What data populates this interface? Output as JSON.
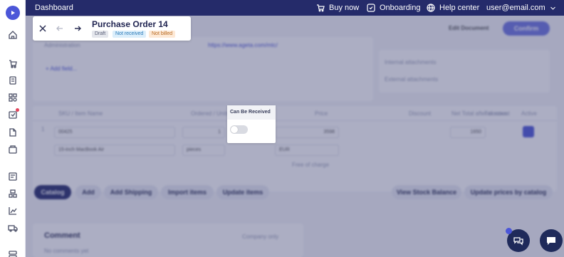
{
  "topbar": {
    "title": "Dashboard",
    "buy_now": "Buy now",
    "onboarding": "Onboarding",
    "help_center": "Help center",
    "user_email": "user@email.com"
  },
  "header": {
    "title": "Purchase Order 14",
    "badges": [
      {
        "label": "Draft",
        "bg": "#e4e6ec",
        "fg": "#5a5f78"
      },
      {
        "label": "Not received",
        "bg": "#dbeefb",
        "fg": "#2a7ab8"
      },
      {
        "label": "Not billed",
        "bg": "#fde9d6",
        "fg": "#b86a22"
      }
    ],
    "edit_document": "Edit Document",
    "confirm": "Confirm"
  },
  "info": {
    "administration": "Administration",
    "url": "https://www.ageta.com/mtc/",
    "add_field": "+ Add field...",
    "internal_attachments": "Internal attachments",
    "external_attachments": "External attachments"
  },
  "table": {
    "headers": {
      "sku_item_name": "SKU / Item Name",
      "ordered_units": "Ordered / Units",
      "price": "Price",
      "discount": "Discount",
      "net_total": "Net Total after discount",
      "tax_rates": "Tax rates",
      "active": "Active"
    },
    "row": {
      "index": "1",
      "sku": "00425",
      "qty": "1",
      "name": "15-inch MacBook Air",
      "unit": "pieces",
      "price": "3598",
      "currency": "EUR",
      "net_total": "1650",
      "free_of_charge": "Free of charge"
    }
  },
  "actions": {
    "catalog": "Catalog",
    "add": "Add",
    "add_shipping": "Add Shipping",
    "import_items": "Import items",
    "update_items": "Update items",
    "view_stock_balance": "View Stock Balance",
    "update_prices": "Update prices by catalog"
  },
  "comment": {
    "title": "Comment",
    "company_only": "Company only",
    "placeholder": "No comments yet"
  },
  "popup": {
    "title": "Can Be Received",
    "toggle_on": false
  },
  "colors": {
    "accent": "#4b56d8",
    "topbar": "#252b6a",
    "overlay": "rgba(58,62,112,0.42)"
  }
}
